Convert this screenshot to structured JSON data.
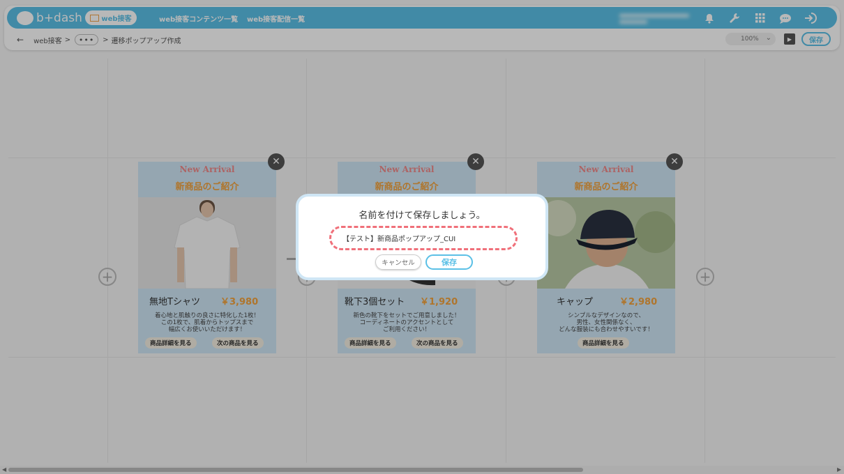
{
  "header": {
    "logo_text": "b+dash",
    "nav_active": "web接客",
    "nav_links": [
      "web接客コンテンツ一覧",
      "web接客配信一覧"
    ],
    "icons": [
      "bell-icon",
      "wrench-icon",
      "grid-icon",
      "chat-icon",
      "logout-icon"
    ]
  },
  "breadcrumb": {
    "back": "←",
    "root": "web接客",
    "sep": ">",
    "dots": "•••",
    "current": "遷移ポップアップ作成"
  },
  "toolbar": {
    "zoom": "100%",
    "save_label": "保存"
  },
  "cards": [
    {
      "en": "New Arrival",
      "ja": "新商品のご紹介",
      "name": "無地Tシャツ",
      "price": "￥3,980",
      "desc": [
        "着心地と肌触りの良さに特化した1枚！",
        "この1枚で、肌着からトップスまで",
        "幅広くお使いいただけます！"
      ],
      "buttons": [
        "商品詳細を見る",
        "次の商品を見る"
      ]
    },
    {
      "en": "New Arrival",
      "ja": "新商品のご紹介",
      "name": "靴下3個セット",
      "price": "￥1,920",
      "desc": [
        "新色の靴下をセットでご用意しました！",
        "コーディネートのアクセントとして",
        "ご利用ください！"
      ],
      "buttons": [
        "商品詳細を見る",
        "次の商品を見る"
      ]
    },
    {
      "en": "New Arrival",
      "ja": "新商品のご紹介",
      "name": "キャップ",
      "price": "￥2,980",
      "desc": [
        "シンプルなデザインなので、",
        "男性、女性関係なく、",
        "どんな服装にも合わせやすいです！"
      ],
      "buttons": [
        "商品詳細を見る"
      ]
    }
  ],
  "modal": {
    "title": "名前を付けて保存しましょう。",
    "input_value": "【テスト】新商品ポップアップ_CUI",
    "cancel_label": "キャンセル",
    "save_label": "保存"
  },
  "colors": {
    "accent": "#5bc0e6",
    "price": "#f3a33d",
    "highlight": "#f0707a"
  }
}
